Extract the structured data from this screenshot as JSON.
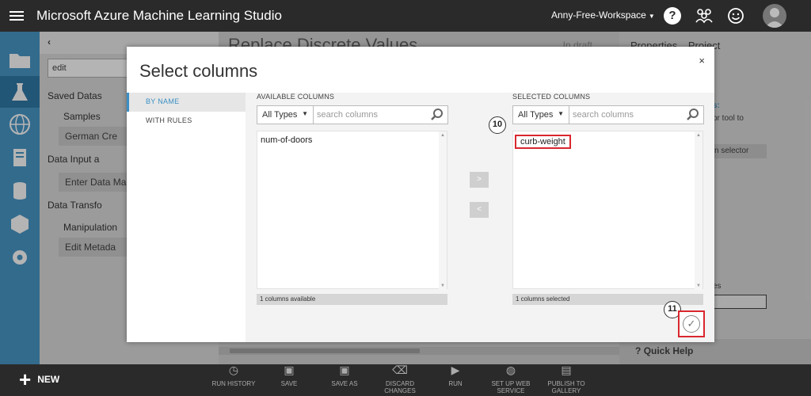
{
  "app": {
    "title": "Microsoft Azure Machine Learning Studio",
    "workspace": "Anny-Free-Workspace"
  },
  "palette": {
    "search_value": "edit",
    "items": [
      {
        "label": "Saved Datas"
      },
      {
        "label": "Samples"
      },
      {
        "label": "German Cre"
      },
      {
        "label": "Data Input a"
      },
      {
        "label": "Enter Data Man"
      },
      {
        "label": "Data Transfo"
      },
      {
        "label": "Manipulation"
      },
      {
        "label": "Edit Metada"
      }
    ]
  },
  "canvas": {
    "title": "Replace Discrete Values",
    "status": "In draft"
  },
  "properties": {
    "tabs": [
      "Properties",
      "Project"
    ],
    "help_label": "Quick Help",
    "fragments": {
      "a": "s:",
      "b": "or tool to",
      "c": "n selector",
      "d": "es"
    }
  },
  "modal": {
    "title": "Select columns",
    "close": "×",
    "nav": [
      "BY NAME",
      "WITH RULES"
    ],
    "available": {
      "heading": "AVAILABLE COLUMNS",
      "type_filter": "All Types",
      "search_placeholder": "search columns",
      "items": [
        "num-of-doors"
      ],
      "count": "1 columns available"
    },
    "selected": {
      "heading": "SELECTED COLUMNS",
      "type_filter": "All Types",
      "search_placeholder": "search columns",
      "items": [
        "curb-weight"
      ],
      "count": "1 columns selected"
    },
    "move_right": ">",
    "move_left": "<",
    "badges": [
      "10",
      "11"
    ]
  },
  "bottom": {
    "new_label": "NEW",
    "buttons": [
      {
        "icon": "history-icon",
        "label": "RUN HISTORY"
      },
      {
        "icon": "save-icon",
        "label": "SAVE"
      },
      {
        "icon": "save-as-icon",
        "label": "SAVE AS"
      },
      {
        "icon": "trash-icon",
        "label": "DISCARD CHANGES"
      },
      {
        "icon": "play-icon",
        "label": "RUN"
      },
      {
        "icon": "globe-icon",
        "label": "SET UP WEB SERVICE"
      },
      {
        "icon": "gallery-icon",
        "label": "PUBLISH TO GALLERY"
      }
    ]
  },
  "colors": {
    "accent": "#3a8fc4",
    "topbar": "#2a2a2a",
    "highlight_red": "#d9272e"
  }
}
